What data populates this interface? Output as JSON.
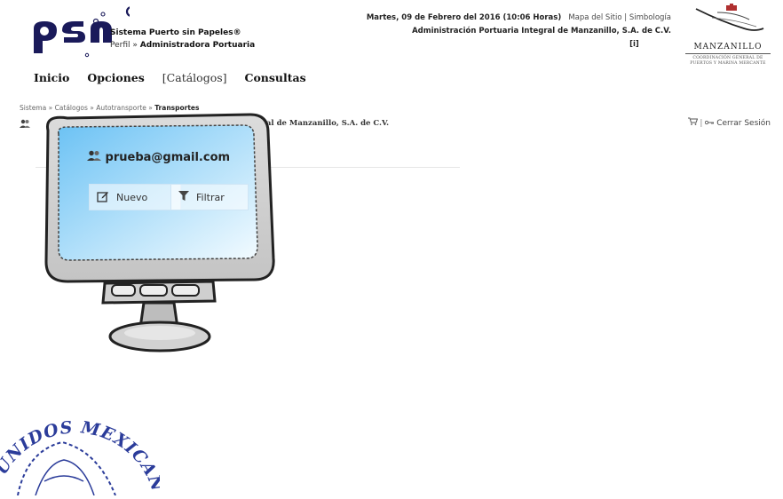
{
  "header": {
    "system_name": "Sistema Puerto sin Papeles®",
    "perfil_prefix": "Perfil »",
    "perfil_value": "Administradora Portuaria",
    "date": "Martes, 09 de Febrero del 2016 (10:06 Horas)",
    "site_map": "Mapa del Sitio",
    "separator": "|",
    "symbology": "Simbología",
    "organization": "Administración Portuaria Integral de Manzanillo, S.A. de C.V.",
    "info_link": "[i]"
  },
  "manzanillo": {
    "name": "MANZANILLO",
    "sub1": "COORDINACIÓN GENERAL DE",
    "sub2": "PUERTOS Y MARINA MERCANTE"
  },
  "menu": [
    "Inicio",
    "Opciones",
    "[Catálogos]",
    "Consultas"
  ],
  "breadcrumb": {
    "path": "Sistema » Catálogos » Autotransporte » ",
    "current": "Transportes"
  },
  "userbar": {
    "org_visible": "Integral de Manzanillo, S.A. de C.V.",
    "logout": "Cerrar Sesión"
  },
  "monitor": {
    "user_email": "prueba@gmail.com",
    "new_button": "Nuevo",
    "filter_button": "Filtrar"
  },
  "seal_text": "UNIDOS MEXICANOS",
  "colors": {
    "accent": "#1a1a5a",
    "screen": "#8fd0f5",
    "seal": "#2b3c9a"
  }
}
